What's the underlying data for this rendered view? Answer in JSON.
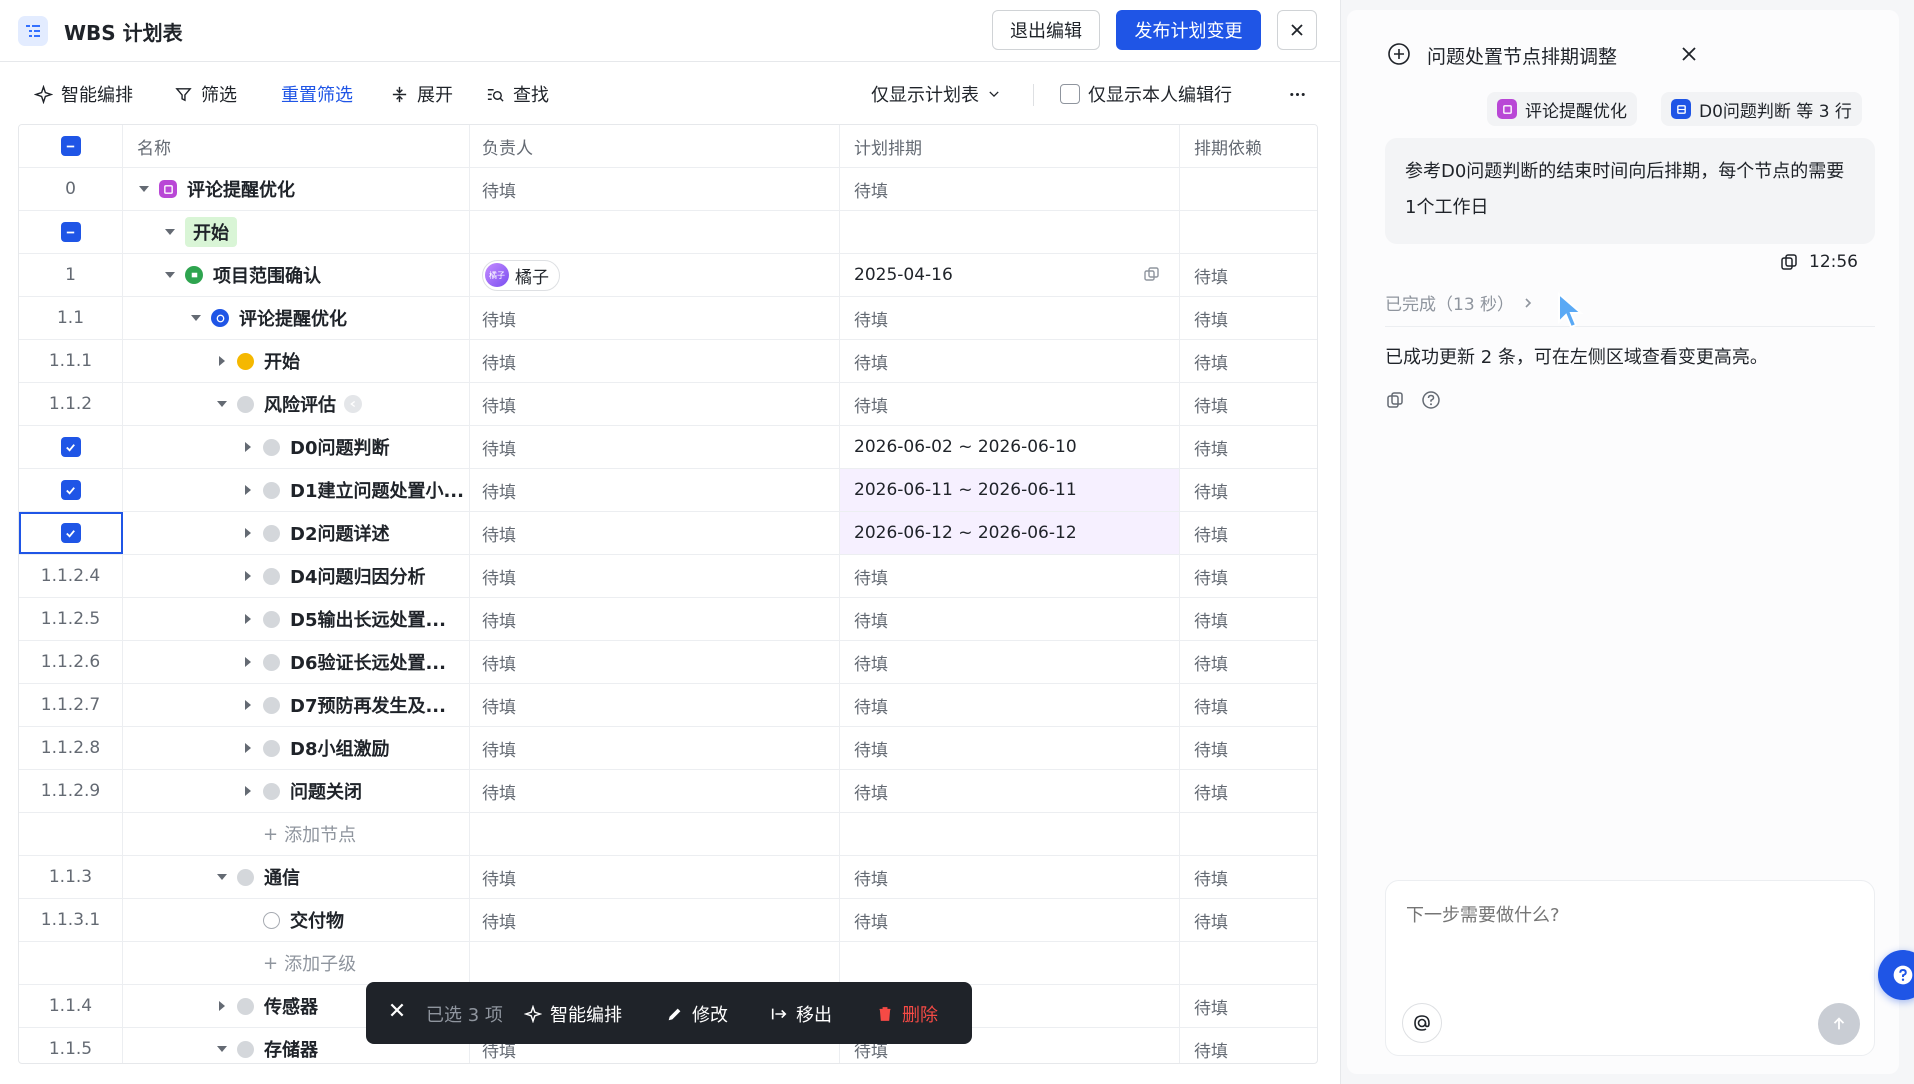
{
  "header": {
    "title": "WBS 计划表",
    "exit_label": "退出编辑",
    "publish_label": "发布计划变更"
  },
  "toolbar": {
    "smart_schedule": "智能编排",
    "filter": "筛选",
    "reset_filter": "重置筛选",
    "expand": "展开",
    "find": "查找",
    "view_select": "仅显示计划表",
    "only_mine": "仅显示本人编辑行"
  },
  "table": {
    "columns": {
      "name": "名称",
      "owner": "负责人",
      "plan": "计划排期",
      "dep": "排期依赖"
    },
    "rows": [
      {
        "idx": "0",
        "name": "评论提醒优化",
        "owner": "待填",
        "plan": "待填",
        "dep": ""
      },
      {
        "idx": "",
        "name": "开始",
        "owner": "",
        "plan": "",
        "dep": ""
      },
      {
        "idx": "1",
        "name": "项目范围确认",
        "owner": "橘子",
        "plan": "2025-04-16",
        "dep": "待填"
      },
      {
        "idx": "1.1",
        "name": "评论提醒优化",
        "owner": "待填",
        "plan": "待填",
        "dep": "待填"
      },
      {
        "idx": "1.1.1",
        "name": "开始",
        "owner": "待填",
        "plan": "待填",
        "dep": "待填"
      },
      {
        "idx": "1.1.2",
        "name": "风险评估",
        "owner": "待填",
        "plan": "待填",
        "dep": "待填"
      },
      {
        "idx": "",
        "name": "D0问题判断",
        "owner": "待填",
        "plan": "2026-06-02 ~ 2026-06-10",
        "dep": "待填"
      },
      {
        "idx": "",
        "name": "D1建立问题处置小...",
        "owner": "待填",
        "plan": "2026-06-11 ~ 2026-06-11",
        "dep": "待填"
      },
      {
        "idx": "",
        "name": "D2问题详述",
        "owner": "待填",
        "plan": "2026-06-12 ~ 2026-06-12",
        "dep": "待填"
      },
      {
        "idx": "1.1.2.4",
        "name": "D4问题归因分析",
        "owner": "待填",
        "plan": "待填",
        "dep": "待填"
      },
      {
        "idx": "1.1.2.5",
        "name": "D5输出长远处置...",
        "owner": "待填",
        "plan": "待填",
        "dep": "待填"
      },
      {
        "idx": "1.1.2.6",
        "name": "D6验证长远处置...",
        "owner": "待填",
        "plan": "待填",
        "dep": "待填"
      },
      {
        "idx": "1.1.2.7",
        "name": "D7预防再发生及...",
        "owner": "待填",
        "plan": "待填",
        "dep": "待填"
      },
      {
        "idx": "1.1.2.8",
        "name": "D8小组激励",
        "owner": "待填",
        "plan": "待填",
        "dep": "待填"
      },
      {
        "idx": "1.1.2.9",
        "name": "问题关闭",
        "owner": "待填",
        "plan": "待填",
        "dep": "待填"
      },
      {
        "idx": "",
        "name": "添加节点",
        "owner": "",
        "plan": "",
        "dep": ""
      },
      {
        "idx": "1.1.3",
        "name": "通信",
        "owner": "待填",
        "plan": "待填",
        "dep": "待填"
      },
      {
        "idx": "1.1.3.1",
        "name": "交付物",
        "owner": "待填",
        "plan": "待填",
        "dep": "待填"
      },
      {
        "idx": "",
        "name": "添加子级",
        "owner": "",
        "plan": "",
        "dep": ""
      },
      {
        "idx": "1.1.4",
        "name": "传感器",
        "owner": "",
        "plan": "",
        "dep": "待填"
      },
      {
        "idx": "1.1.5",
        "name": "存储器",
        "owner": "待填",
        "plan": "待填",
        "dep": "待填"
      }
    ],
    "owner_avatar_text": "橘子"
  },
  "actionbar": {
    "selected": "已选 3 项",
    "smart": "智能编排",
    "edit": "修改",
    "move_out": "移出",
    "delete": "删除"
  },
  "assistant": {
    "title": "问题处置节点排期调整",
    "chip1": "评论提醒优化",
    "chip2": "D0问题判断 等 3 行",
    "message": "参考D0问题判断的结束时间向后排期，每个节点的需要1个工作日",
    "time": "12:56",
    "done": "已完成（13 秒）",
    "answer": "已成功更新 2 条，可在左侧区域查看变更高亮。",
    "input_placeholder": "下一步需要做什么?"
  },
  "colors": {
    "accent": "#1f55e6",
    "highlight": "#f6f0ff",
    "danger": "#f54a45"
  }
}
